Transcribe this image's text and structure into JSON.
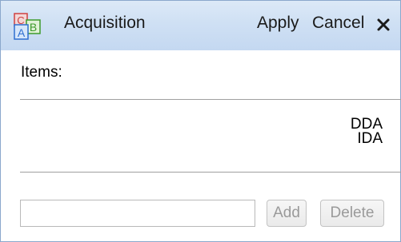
{
  "window": {
    "title": "Acquisition",
    "apply_label": "Apply",
    "cancel_label": "Cancel",
    "close_icon": "close-icon",
    "app_icon": "abc-icon"
  },
  "items_section": {
    "label": "Items:",
    "items": [
      "DDA",
      "IDA"
    ]
  },
  "entry": {
    "input_value": "",
    "add_label": "Add",
    "delete_label": "Delete",
    "add_enabled": false,
    "delete_enabled": false
  },
  "colors": {
    "titlebar": "#cfe0f4",
    "border": "#8ba8cc",
    "disabled_text": "#9a9a9a"
  }
}
